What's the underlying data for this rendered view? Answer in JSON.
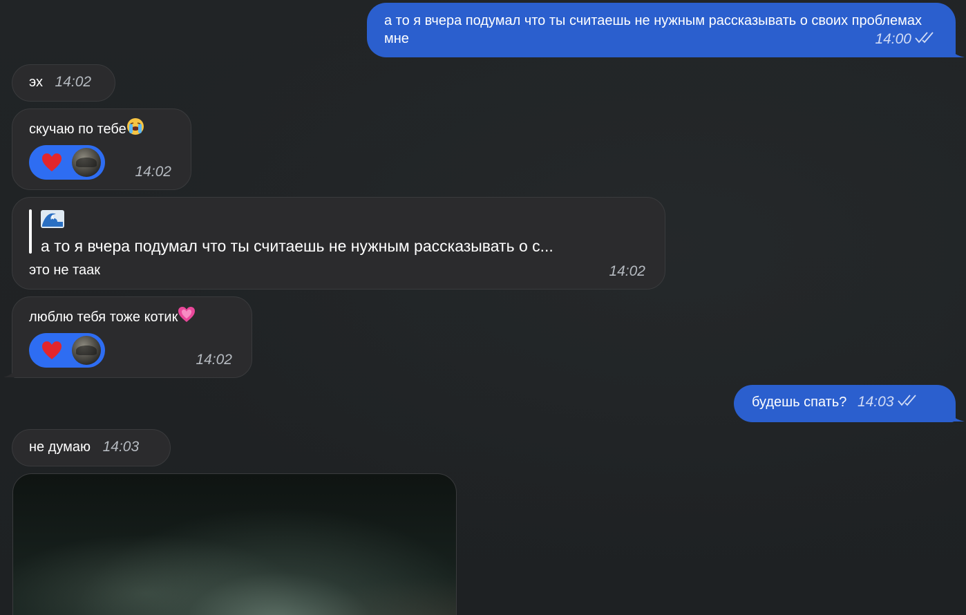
{
  "messages": [
    {
      "id": "m1",
      "direction": "outgoing",
      "text": "а то я вчера подумал что ты считаешь не нужным рассказывать о своих проблемах мне",
      "time": "14:00",
      "read": true
    },
    {
      "id": "m2",
      "direction": "incoming",
      "text": "эх",
      "time": "14:02"
    },
    {
      "id": "m3",
      "direction": "incoming",
      "text": "скучаю по тебе",
      "emoji": "loudly-crying-face",
      "time": "14:02",
      "reaction": {
        "emoji": "red-heart",
        "by": "avatar"
      }
    },
    {
      "id": "m4",
      "direction": "incoming",
      "reply": {
        "sender_emoji": "water-wave",
        "quote": "а то я вчера подумал что ты считаешь не нужным рассказывать о с..."
      },
      "text": "это не таак",
      "time": "14:02"
    },
    {
      "id": "m5",
      "direction": "incoming",
      "text": "люблю тебя тоже котик",
      "emoji": "pink-heart",
      "time": "14:02",
      "reaction": {
        "emoji": "red-heart",
        "by": "avatar"
      }
    },
    {
      "id": "m6",
      "direction": "outgoing",
      "text": "будешь спать?",
      "time": "14:03",
      "read": true
    },
    {
      "id": "m7",
      "direction": "incoming",
      "text": "не думаю",
      "time": "14:03"
    },
    {
      "id": "m8",
      "direction": "incoming",
      "type": "media"
    }
  ],
  "colors": {
    "background": "#1f2224",
    "incoming_bubble": "#2b2b2d",
    "outgoing_bubble": "#2b5fce",
    "reaction_pill": "#2e6df2"
  }
}
